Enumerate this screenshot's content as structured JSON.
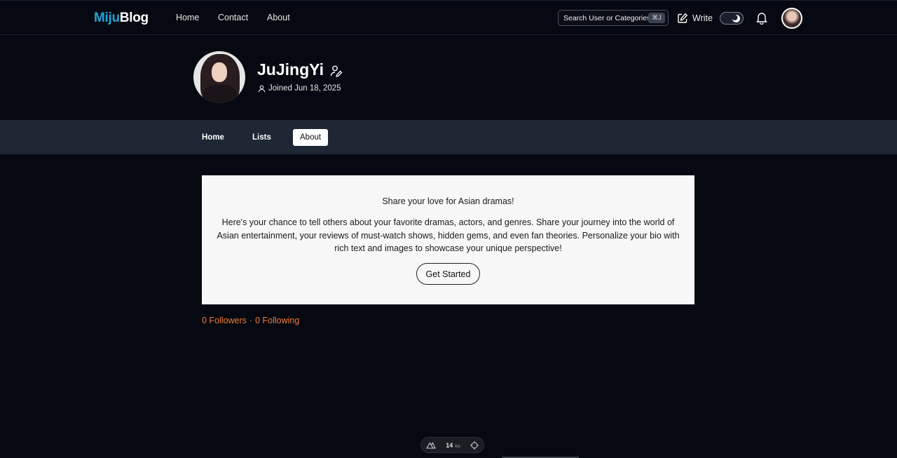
{
  "header": {
    "logo_part1": "Miju",
    "logo_part2": "Blog",
    "nav": [
      "Home",
      "Contact",
      "About"
    ],
    "search_placeholder": "Search User or Categories...",
    "search_shortcut": "⌘J",
    "write_label": "Write",
    "theme_toggle": "dark-mode",
    "icons": {
      "write": "pencil-square-icon",
      "bell": "bell-icon"
    }
  },
  "profile": {
    "name": "JuJingYi",
    "joined": "Joined Jun 18, 2025"
  },
  "tabs": [
    {
      "label": "Home",
      "active": false
    },
    {
      "label": "Lists",
      "active": false
    },
    {
      "label": "About",
      "active": true
    }
  ],
  "about_card": {
    "title": "Share your love for Asian dramas!",
    "body": "Here's your chance to tell others about your favorite dramas, actors, and genres. Share your journey into the world of Asian entertainment, your reviews of must-watch shows, hidden gems, and even fan theories. Personalize your bio with rich text and images to showcase your unique perspective!",
    "button": "Get Started"
  },
  "follow": {
    "followers": "0 Followers",
    "separator": "·",
    "following": "0 Following"
  },
  "dev_indicator": {
    "time_value": "14",
    "time_unit": "ms"
  },
  "colors": {
    "background": "#060911",
    "tabbar": "#1f2735",
    "logo_accent": "#22a4d9",
    "follow_text": "#f07b3a"
  }
}
